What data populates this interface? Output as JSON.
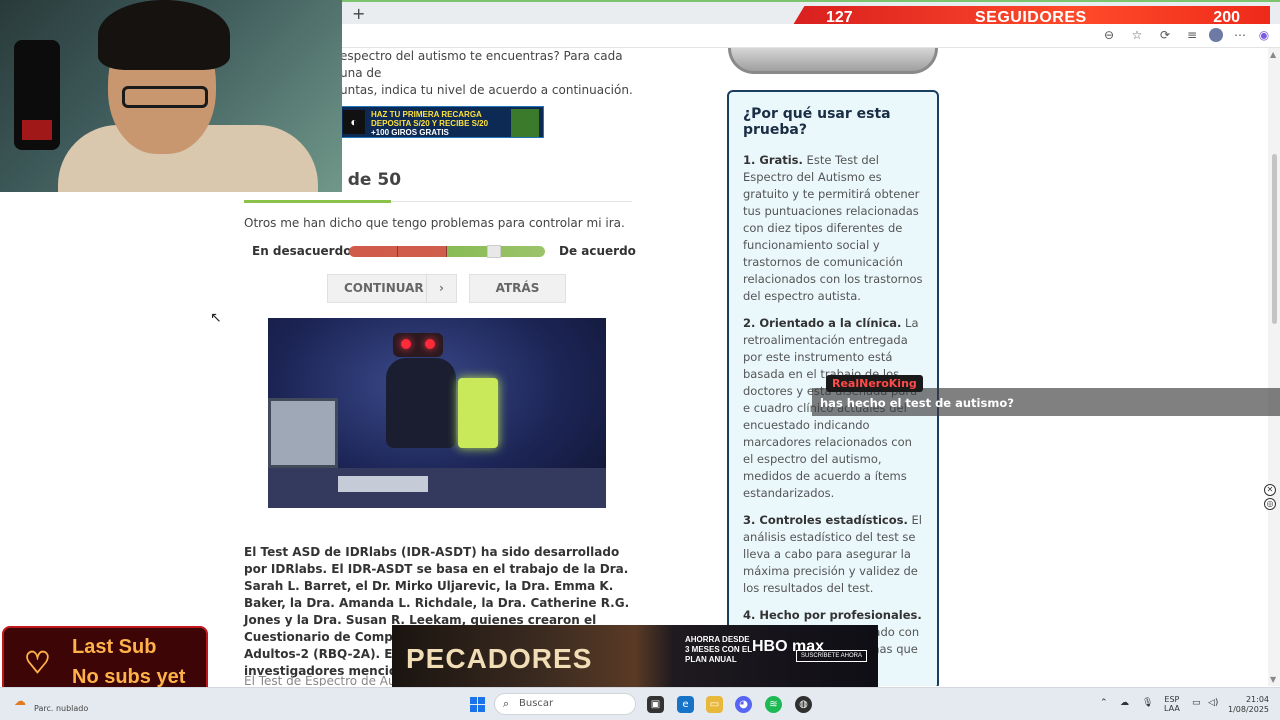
{
  "browser": {
    "new_tab_label": "+",
    "toolbar_icons": [
      "reader-icon",
      "favorite-star-icon",
      "extensions-icon",
      "collections-icon",
      "profile-avatar-icon",
      "more-menu-icon",
      "copilot-icon"
    ]
  },
  "followers": {
    "count": "127",
    "label": "SEGUIDORES",
    "goal": "200"
  },
  "page": {
    "intro_text": "espectro del autismo te encuentras? Para cada una de",
    "intro_text2": "untas, indica tu nivel de acuerdo a continuación.",
    "ad_top": {
      "line1": "HAZ TU PRIMERA RECARGA",
      "line2": "DEPOSITA S/20 Y RECIBE S/20",
      "line3": "+100 GIROS GRATIS"
    },
    "question_counter": "0 de 50",
    "progress": 0.38,
    "question": "Otros me han dicho que tengo problemas para controlar mi ira.",
    "scale": {
      "left_label": "En desacuerdo",
      "right_label": "De acuerdo",
      "value": 0.74
    },
    "buttons": {
      "continue": "CONTINUAR",
      "continue_arrow": "›",
      "back": "ATRÁS"
    },
    "body_text": "El Test ASD de IDRlabs (IDR-ASDT) ha sido desarrollado por IDRlabs. El IDR-ASDT se basa en el trabajo de la Dra. Sarah L. Barret, el Dr. Mirko Uljarevic, la Dra. Emma K. Baker, la Dra. Amanda L. Richdale, la Dra. Catherine R.G. Jones y la Dra. Susan R. Leekam, quienes crearon el Cuestionario de Comportamientos Repetitivos en Adultos-2 (RBQ-2A). El IDR-",
    "body_text_tail": "investigadores menciona",
    "body_text2": "El Test de Espectro de Autis"
  },
  "sidebar": {
    "title": "¿Por qué usar esta prueba?",
    "items": [
      {
        "head": "1. Gratis.",
        "text": " Este Test del Espectro del Autismo es gratuito y te permitirá obtener tus puntuaciones relacionadas con diez tipos diferentes de funcionamiento social y trastornos de comunicación relacionados con los trastornos del espectro autista."
      },
      {
        "head": "2. Orientado a la clínica.",
        "text": " La retroalimentación entregada por este instrumento está basada en el trabajo de los doctores y está diseñada para e cuadro clínico actuales del encuestado indicando marcadores relacionados con el espectro del autismo, medidos de acuerdo a ítems estandarizados."
      },
      {
        "head": "3. Controles estadísticos.",
        "text": " El análisis estadístico del test se lleva a cabo para asegurar la máxima precisión y validez de los resultados del test."
      },
      {
        "head": "4. Hecho por profesionales.",
        "text": " Este test ha sido realizado con la aportación de personas que"
      }
    ]
  },
  "chat": {
    "user": "RealNeroKing",
    "message": "has hecho el test de autismo?"
  },
  "last_sub": {
    "line1": "Last Sub",
    "line2": "No subs yet"
  },
  "ad_bottom": {
    "title": "PECADORES",
    "promo": "AHORRA DESDE 3 MESES CON EL PLAN ANUAL",
    "brand": "HBO max",
    "cta": "SUSCRÍBETE AHORA"
  },
  "taskbar": {
    "weather": "Parc. nublado",
    "search_placeholder": "Buscar",
    "lang1": "ESP",
    "lang2": "LAA",
    "time": "21:04",
    "date": "1/08/2025"
  },
  "colors": {
    "accent_green": "#8bc34a",
    "box_bg": "#eaf7fb",
    "box_border": "#1c3e5e",
    "followers_red": "#e52a1f"
  }
}
